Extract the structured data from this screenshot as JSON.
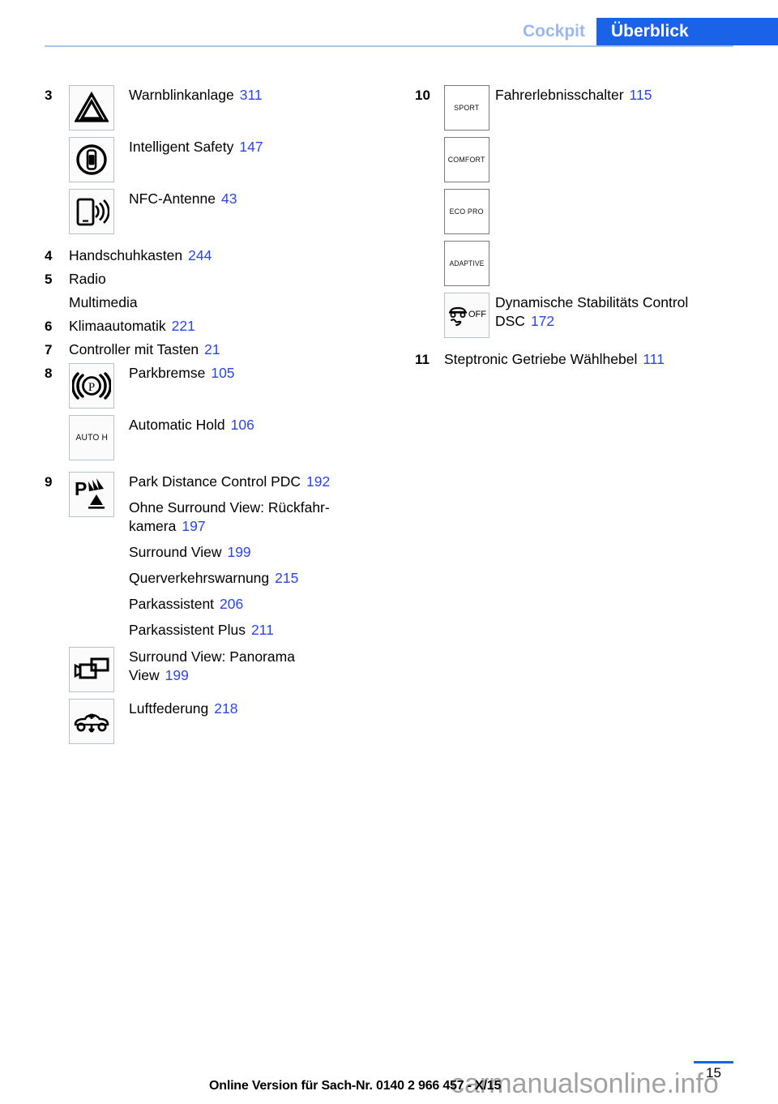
{
  "header": {
    "breadcrumb_inactive": "Cockpit",
    "breadcrumb_active": "Überblick",
    "accent_color": "#1a62e8",
    "inactive_color": "#9bb8ef"
  },
  "left_column": {
    "items": [
      {
        "number": "3",
        "icon": "hazard-warning-triangle-icon",
        "label": "Warnblinkanlage",
        "page": "311"
      },
      {
        "number": "",
        "icon": "intelligent-safety-icon",
        "label": "Intelligent Safety",
        "page": "147"
      },
      {
        "number": "",
        "icon": "nfc-antenna-icon",
        "label": "NFC-Antenne",
        "page": "43"
      },
      {
        "number": "4",
        "icon": null,
        "label": "Handschuhkasten",
        "page": "244"
      },
      {
        "number": "5",
        "icon": null,
        "label": "Radio",
        "page": ""
      },
      {
        "number": "",
        "icon": null,
        "label": "Multimedia",
        "page": ""
      },
      {
        "number": "6",
        "icon": null,
        "label": "Klimaautomatik",
        "page": "221"
      },
      {
        "number": "7",
        "icon": null,
        "label": "Controller mit Tasten",
        "page": "21"
      },
      {
        "number": "8",
        "icon": "parking-brake-icon",
        "label": "Parkbremse",
        "page": "105"
      },
      {
        "number": "",
        "icon": "auto-hold-icon",
        "label": "Automatic Hold",
        "page": "106"
      },
      {
        "number": "9",
        "icon": "park-distance-control-icon",
        "label": "Park Distance Control PDC",
        "page": "192"
      }
    ],
    "pdc_sublist": [
      {
        "label_line1": "Ohne Surround View: Rückfahr-",
        "label_line2": "kamera",
        "page": "197"
      },
      {
        "label_line1": "Surround View",
        "label_line2": "",
        "page": "199"
      },
      {
        "label_line1": "Querverkehrswarnung",
        "label_line2": "",
        "page": "215"
      },
      {
        "label_line1": "Parkassistent",
        "label_line2": "",
        "page": "206"
      },
      {
        "label_line1": "Parkassistent Plus",
        "label_line2": "",
        "page": "211"
      }
    ],
    "trailing_icon_items": [
      {
        "icon": "surround-view-camera-icon",
        "label_line1": "Surround View: Panorama",
        "label_line2": "View",
        "page": "199"
      },
      {
        "icon": "air-suspension-icon",
        "label_line1": "Luftfederung",
        "label_line2": "",
        "page": "218"
      }
    ]
  },
  "right_column": {
    "item_10": {
      "number": "10",
      "label": "Fahrerlebnisschalter",
      "page": "115"
    },
    "mode_icons": [
      {
        "icon": "sport-mode-icon",
        "text": "SPORT"
      },
      {
        "icon": "comfort-mode-icon",
        "text": "COMFORT"
      },
      {
        "icon": "eco-pro-mode-icon",
        "text": "ECO PRO"
      },
      {
        "icon": "adaptive-mode-icon",
        "text": "ADAPTIVE"
      }
    ],
    "dsc": {
      "icon": "dsc-off-icon",
      "label_line1": "Dynamische Stabilitäts Control",
      "label_line2": "DSC",
      "page": "172"
    },
    "item_11": {
      "number": "11",
      "label": "Steptronic Getriebe Wählhebel",
      "page": "111"
    }
  },
  "footer": {
    "page_number": "15",
    "online_version": "Online Version für Sach-Nr. 0140 2 966 457 - X/15",
    "watermark": "carmanualsonline.info"
  }
}
